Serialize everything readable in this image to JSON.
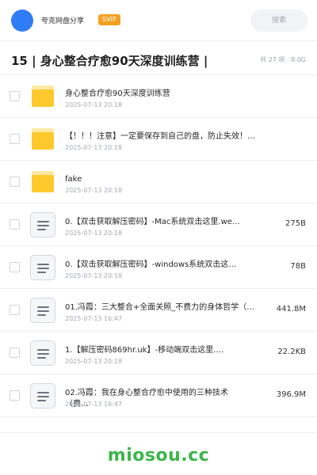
{
  "header": {
    "brand": "夸克网盘分享",
    "badge": "SVIP",
    "search_label": "搜索"
  },
  "folder": {
    "title": "15 | 身心整合疗愈90天深度训练营 |",
    "stats": "共 27 项 · 8.0G"
  },
  "files": [
    {
      "type": "folder",
      "name": "身心整合疗愈90天深度训练营",
      "date": "2025-07-13 20:18",
      "size": ""
    },
    {
      "type": "folder",
      "name": "【！！！注意】一定要保存到自己的盘，防止失效！！！",
      "date": "2025-07-13 20:18",
      "size": ""
    },
    {
      "type": "folder",
      "name": "fake",
      "date": "2025-07-13 20:18",
      "size": ""
    },
    {
      "type": "file",
      "name": "0.【双击获取解压密码】-Mac系统双击这里.we…",
      "date": "2025-07-13 20:18",
      "size": "275B"
    },
    {
      "type": "file",
      "name": "0.【双击获取解压密码】-windows系统双击这…",
      "date": "2025-07-13 20:18",
      "size": "78B"
    },
    {
      "type": "file",
      "name": "01.冯霞：三大整合+全面关照_不费力的身体哲学（…",
      "date": "2025-07-13 16:47",
      "size": "441.8M"
    },
    {
      "type": "file",
      "name": "1.【解压密码869hr.uk】-移动端双击这里.…",
      "date": "2025-07-13 20:18",
      "size": "22.2KB"
    },
    {
      "type": "file",
      "name": "02.冯霞：我在身心整合疗愈中使用的三种技术（费…",
      "date": "2025-07-13 16:47",
      "size": "396.9M"
    }
  ],
  "watermark": "miosou.cc",
  "colors": {
    "avatar": "#2f7cf6",
    "svip_badge": "#f5a020",
    "folder": "#ffc92e",
    "watermark": "#3cb54a"
  },
  "icons": {
    "folder": "folder-icon",
    "file": "document-icon"
  }
}
